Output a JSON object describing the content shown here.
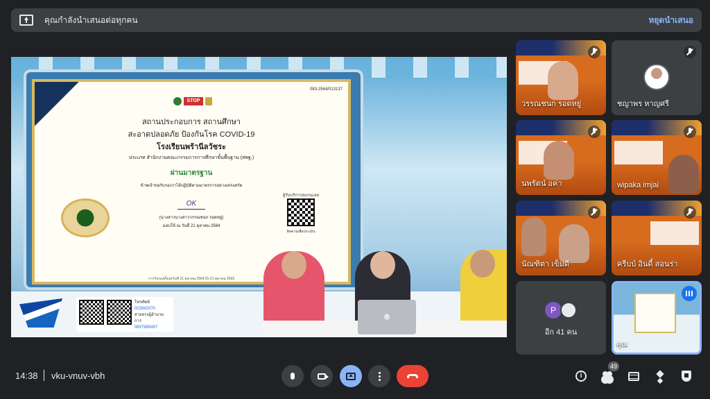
{
  "banner": {
    "message": "คุณกำลังนำเสนอต่อทุกคน",
    "stop_label": "หยุดนำเสนอ"
  },
  "presentation": {
    "certificate": {
      "serial": "083-2564/013137",
      "logo_text": "Thai STOP COVID",
      "line1": "สถานประกอบการ สถานศึกษา",
      "line2": "สะอาดปลอดภัย ป้องกันโรค COVID-19",
      "school": "โรงเรียนพร้านีลวัชระ",
      "category": "ประเภท สำนักงานคณะกรรมการการศึกษาขั้นพื้นฐาน (สพฐ.)",
      "status": "ผ่านมาตรฐาน",
      "pledge": "ข้าพเจ้าขอรับรองว่าได้ปฏิบัติตามมาตรการอย่างเคร่งครัด",
      "signature": "OK",
      "signer": "(นางสาวนางสาววรรณชนก รอดหยู่)",
      "date": "มอบให้ ณ วันที่ 21 ตุลาคม 2564",
      "qr_title": "ผู้รับบริการสแกนเลย",
      "qr_sub": "ติดตามเพื่อประเมิน",
      "footer": "การรับรองตั้งแต่วันที่ 21 ตุลาคม 2564 ถึง 21 ตุลาคม 2565"
    },
    "contact": {
      "phone_label": "โทรศัพท์",
      "phone": "023942070",
      "hotline_label": "สายตรงผู้อำนวยการ",
      "hotline": "0897989497"
    }
  },
  "participants": [
    {
      "name": "วรรณชนก รอดหยู่",
      "muted": true
    },
    {
      "name": "ชญาพร หาญศรี",
      "muted": true
    },
    {
      "name": "นพรัตน์ อค่า",
      "muted": true
    },
    {
      "name": "wipaka imjai",
      "muted": true
    },
    {
      "name": "นัณฑิตา เข็มดี",
      "muted": true
    },
    {
      "name": "ครีบบ์ อินดี้ สอนร่า",
      "muted": true
    }
  ],
  "more_participants": {
    "initial": "P",
    "label": "อีก 41 คน"
  },
  "self_tile": {
    "label": "คุณ"
  },
  "bottom_bar": {
    "time": "14:38",
    "meeting_code": "vku-vnuv-vbh",
    "people_count": "49"
  },
  "colors": {
    "accent": "#8ab4f8",
    "end_call": "#ea4335",
    "surface": "#3c4043",
    "background": "#202124"
  },
  "icons": [
    "present-screen-icon",
    "mic-icon",
    "camera-icon",
    "present-icon",
    "more-options-icon",
    "hang-up-icon",
    "info-icon",
    "people-icon",
    "chat-icon",
    "activities-icon",
    "host-controls-icon",
    "mic-off-icon",
    "speaking-icon"
  ]
}
